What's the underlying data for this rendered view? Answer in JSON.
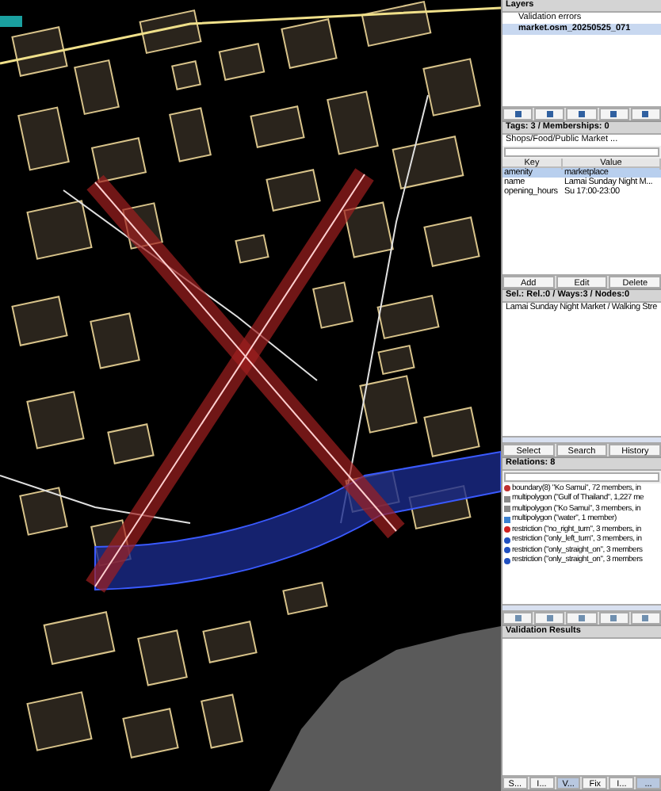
{
  "layers": {
    "title": "Layers",
    "items": [
      {
        "name": "Validation errors",
        "selected": false
      },
      {
        "name": "market.osm_20250525_071",
        "selected": true
      }
    ]
  },
  "tags": {
    "title": "Tags: 3 / Memberships: 0",
    "preset": "Shops/Food/Public Market ...",
    "columns": [
      "Key",
      "Value"
    ],
    "rows": [
      {
        "key": "amenity",
        "value": "marketplace",
        "selected": true
      },
      {
        "key": "name",
        "value": "Lamai Sunday Night M...",
        "selected": false
      },
      {
        "key": "opening_hours",
        "value": "Su 17:00-23:00",
        "selected": false
      }
    ],
    "buttons": [
      "Add",
      "Edit",
      "Delete"
    ]
  },
  "selection": {
    "title": "Sel.: Rel.:0 / Ways:3 / Nodes:0",
    "items": [
      "Lamai Sunday Night Market / Walking Stre"
    ],
    "buttons": [
      "Select",
      "Search",
      "History"
    ]
  },
  "relations": {
    "title": "Relations: 8",
    "items": [
      {
        "kind": "boundary",
        "text": "boundary(8) \"Ko Samui\", 72 members, in"
      },
      {
        "kind": "multipolygon",
        "text": "multipolygon (\"Gulf of Thailand\", 1,227 me"
      },
      {
        "kind": "multipolygon",
        "text": "multipolygon (\"Ko Samui\", 3 members, in"
      },
      {
        "kind": "water",
        "text": "multipolygon (\"water\", 1 member)"
      },
      {
        "kind": "prohibit",
        "text": "restriction (\"no_right_turn\", 3 members, in"
      },
      {
        "kind": "mandatory",
        "text": "restriction (\"only_left_turn\", 3 members, in"
      },
      {
        "kind": "mandatory",
        "text": "restriction (\"only_straight_on\", 3 members"
      },
      {
        "kind": "mandatory",
        "text": "restriction (\"only_straight_on\", 3 members"
      }
    ]
  },
  "validation": {
    "title": "Validation Results",
    "buttons": [
      {
        "label": "S...",
        "selected": false
      },
      {
        "label": "I...",
        "selected": false
      },
      {
        "label": "V...",
        "selected": true
      },
      {
        "label": "Fix",
        "selected": false
      },
      {
        "label": "I...",
        "selected": false
      },
      {
        "label": "...",
        "selected": true
      }
    ]
  }
}
